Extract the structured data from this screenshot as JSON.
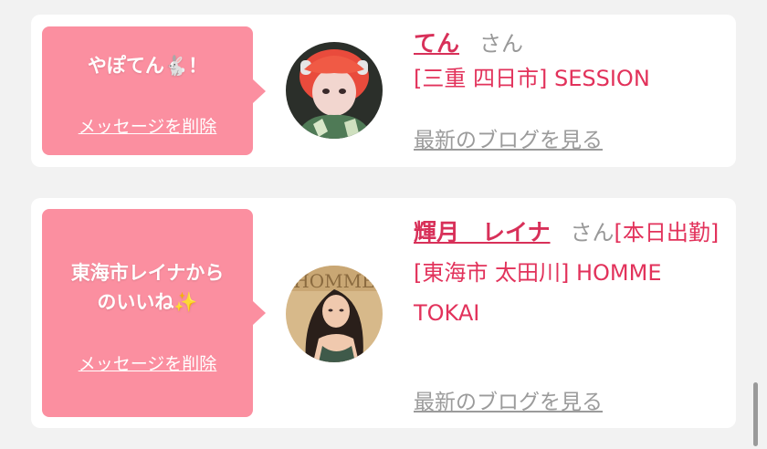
{
  "likes": [
    {
      "message": "やぽてん🐇！",
      "delete_label": "メッセージを削除",
      "name": "てん",
      "honorific": "さん",
      "status": "",
      "location": "[三重 四日市] SESSION",
      "blog_link": "最新のブログを見る",
      "colors": {
        "bubble": "#fb8fa0",
        "accent": "#e2325b"
      }
    },
    {
      "message_line1": "東海市レイナから",
      "message_line2": "のいいね✨",
      "delete_label": "メッセージを削除",
      "name": "輝月　レイナ",
      "honorific": "さん",
      "status": "[本日出勤]",
      "location": "[東海市 太田川] HOMME TOKAI",
      "blog_link": "最新のブログを見る"
    }
  ]
}
